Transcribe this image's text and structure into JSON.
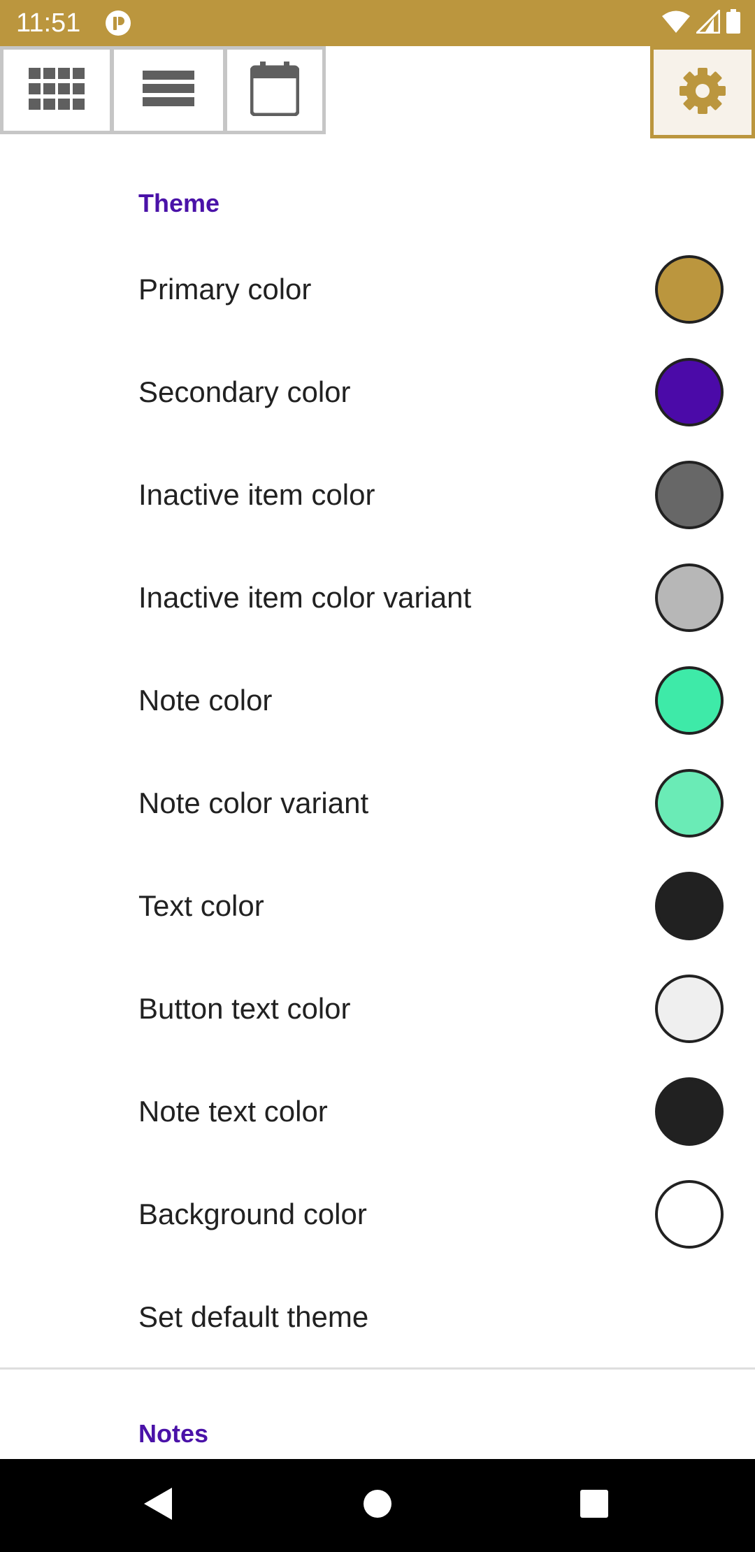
{
  "status_bar": {
    "time": "11:51",
    "background": "#bb963e",
    "icons": [
      "app-notification-icon",
      "wifi-icon",
      "signal-icon",
      "battery-icon"
    ]
  },
  "toolbar": {
    "buttons": [
      {
        "name": "grid-view",
        "icon": "grid-icon"
      },
      {
        "name": "list-view",
        "icon": "list-icon"
      },
      {
        "name": "calendar-view",
        "icon": "calendar-icon"
      },
      {
        "name": "settings",
        "icon": "gear-icon",
        "active": true
      }
    ]
  },
  "theme_section": {
    "title": "Theme",
    "items": [
      {
        "label": "Primary color",
        "color": "#bb963e"
      },
      {
        "label": "Secondary color",
        "color": "#4b0aa8"
      },
      {
        "label": "Inactive item color",
        "color": "#676767"
      },
      {
        "label": "Inactive item color variant",
        "color": "#b7b7b7"
      },
      {
        "label": "Note color",
        "color": "#3eeaa8"
      },
      {
        "label": "Note color variant",
        "color": "#6aebb6"
      },
      {
        "label": "Text color",
        "color": "#212121"
      },
      {
        "label": "Button text color",
        "color": "#efefef"
      },
      {
        "label": "Note text color",
        "color": "#212121"
      },
      {
        "label": "Background color",
        "color": "#ffffff"
      }
    ],
    "set_default_label": "Set default theme"
  },
  "notes_section": {
    "title": "Notes"
  },
  "colors": {
    "accent": "#bb963e",
    "section_header": "#4a12a8"
  }
}
